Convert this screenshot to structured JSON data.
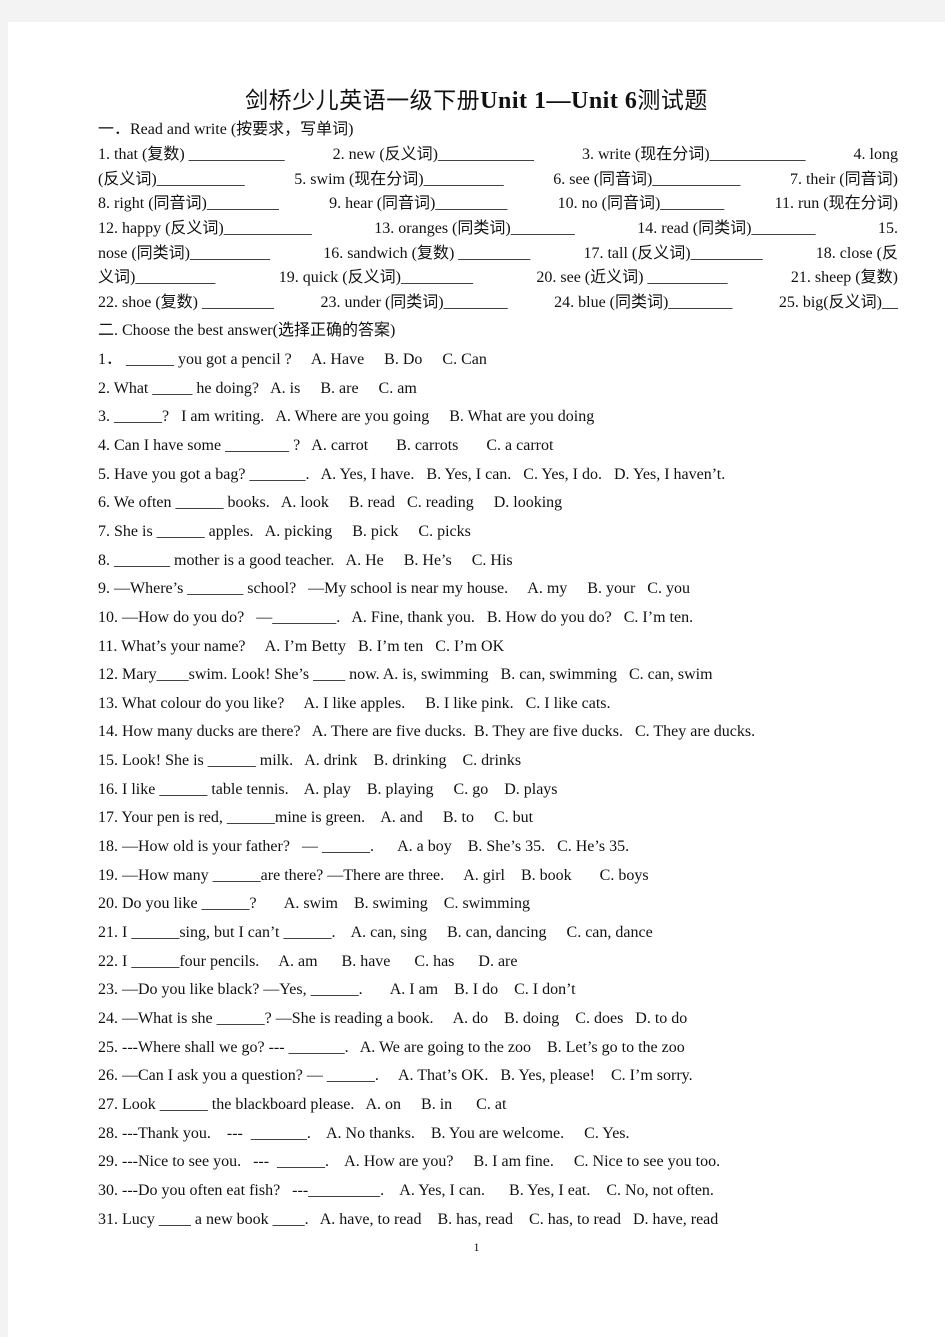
{
  "title": {
    "cn_prefix": "剑桥少儿英语一级下册",
    "en": "Unit 1—Unit 6",
    "cn_suffix": "测试题"
  },
  "section1": {
    "heading": "一．Read and write (按要求，写单词)",
    "lines": [
      [
        "1. that (复数) ____________",
        "2. new (反义词)____________",
        "3. write (现在分词)____________",
        "4. long"
      ],
      [
        "(反义词)___________",
        "5. swim (现在分词)__________",
        "6. see (同音词)___________",
        "7. their (同音词)"
      ],
      [
        "8. right (同音词)_________",
        "9. hear (同音词)_________",
        "10. no (同音词)________",
        "11. run (现在分词)"
      ],
      [
        "12. happy (反义词)___________",
        "13. oranges (同类词)________",
        "14. read (同类词)________",
        "15."
      ],
      [
        "nose (同类词)__________",
        "16. sandwich (复数) _________",
        "17. tall (反义词)_________",
        "18. close (反"
      ],
      [
        "义词)__________",
        "19. quick (反义词)_________",
        "20. see (近义词) __________",
        "21. sheep (复数)"
      ],
      [
        "22. shoe (复数) _________",
        "23. under (同类词)________",
        "24. blue (同类词)________",
        "25. big(反义词)__"
      ]
    ]
  },
  "section2": {
    "heading": "二. Choose the best answer(选择正确的答案)",
    "questions": [
      "1． ______ you got a pencil ?     A. Have     B. Do     C. Can",
      "2. What _____ he doing?   A. is     B. are     C. am",
      "3. ______?   I am writing.   A. Where are you going     B. What are you doing",
      "4. Can I have some ________ ?   A. carrot       B. carrots       C. a carrot",
      "5. Have you got a bag? _______.   A. Yes, I have.   B. Yes, I can.   C. Yes, I do.   D. Yes, I haven’t.",
      "6. We often ______ books.   A. look     B. read   C. reading     D. looking",
      "7. She is ______ apples.   A. picking     B. pick     C. picks",
      "8. _______ mother is a good teacher.   A. He     B. He’s     C. His",
      "9. —Where’s _______ school?   —My school is near my house.     A. my     B. your   C. you",
      "10. —How do you do?   —________.   A. Fine, thank you.   B. How do you do?   C. I’m ten.",
      "11. What’s your name?     A. I’m Betty   B. I’m ten   C. I’m OK",
      "12. Mary____swim. Look! She’s ____ now. A. is, swimming   B. can, swimming   C. can, swim",
      "13. What colour do you like?     A. I like apples.     B. I like pink.   C. I like cats.",
      "14. How many ducks are there?   A. There are five ducks.  B. They are five ducks.   C. They are ducks.",
      "15. Look! She is ______ milk.   A. drink    B. drinking    C. drinks",
      "16. I like ______ table tennis.    A. play    B. playing     C. go    D. plays",
      "17. Your pen is red, ______mine is green.    A. and     B. to     C. but",
      "18. —How old is your father?   — ______.      A. a boy    B. She’s 35.   C. He’s 35.",
      "19. —How many ______are there? —There are three.     A. girl    B. book       C. boys",
      "20. Do you like ______?       A. swim    B. swiming    C. swimming",
      "21. I ______sing, but I can’t ______.    A. can, sing     B. can, dancing     C. can, dance",
      "22. I ______four pencils.     A. am      B. have      C. has      D. are",
      "23. —Do you like black? —Yes, ______.       A. I am    B. I do    C. I don’t",
      "24. —What is she ______? —She is reading a book.     A. do    B. doing    C. does   D. to do",
      "25. ---Where shall we go? --- _______.   A. We are going to the zoo    B. Let’s go to the zoo",
      "26. —Can I ask you a question? — ______.     A. That’s OK.   B. Yes, please!    C. I’m sorry.",
      "27. Look ______ the blackboard please.   A. on     B. in      C. at",
      "28. ---Thank you.    ---  _______.    A. No thanks.    B. You are welcome.     C. Yes.",
      "29. ---Nice to see you.   ---  ______.    A. How are you?     B. I am fine.     C. Nice to see you too.",
      "30. ---Do you often eat fish?   ---_________.    A. Yes, I can.      B. Yes, I eat.    C. No, not often.",
      "31. Lucy ____ a new book ____.   A. have, to read    B. has, read    C. has, to read   D. have, read"
    ]
  },
  "page_number": "1"
}
